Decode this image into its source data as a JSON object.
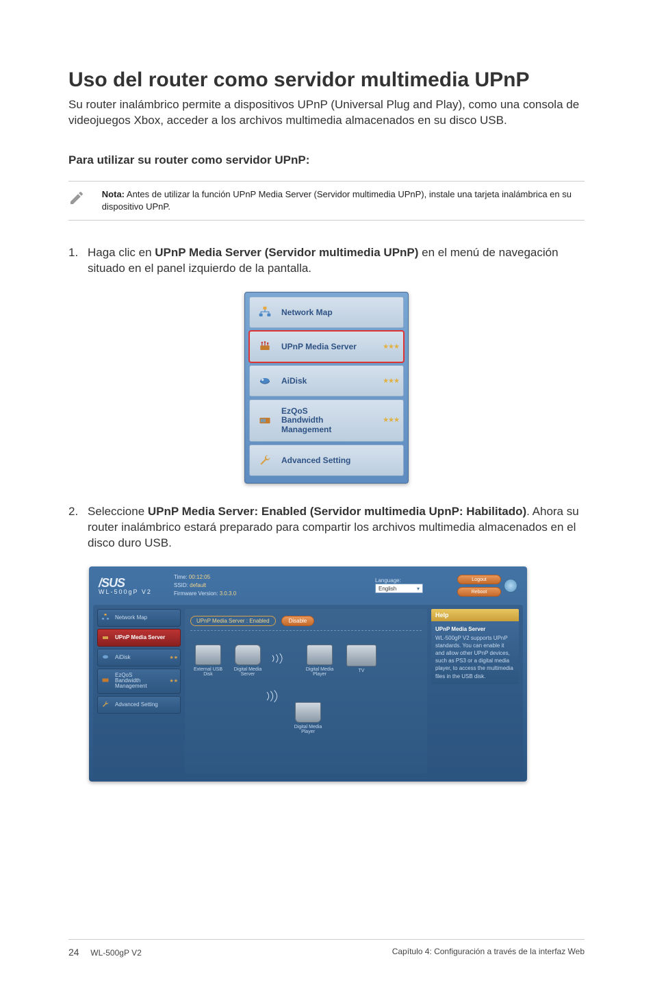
{
  "heading": "Uso del router como servidor multimedia UPnP",
  "intro": "Su router inalámbrico permite a dispositivos UPnP (Universal Plug and Play), como una consola de videojuegos Xbox, acceder a los archivos multimedia almacenados en su disco USB.",
  "subheading": "Para utilizar su router como servidor UPnP:",
  "note": {
    "label": "Nota:",
    "text": " Antes de utilizar la función UPnP Media Server (Servidor multimedia UPnP), instale una tarjeta inalámbrica en su dispositivo UPnP."
  },
  "steps": [
    {
      "num": "1.",
      "pre": "Haga clic en ",
      "bold": "UPnP Media Server (Servidor multimedia UPnP)",
      "post": " en el menú de navegación situado en el panel izquierdo de la pantalla."
    },
    {
      "num": "2.",
      "pre": "Seleccione ",
      "bold": "UPnP Media Server: Enabled (Servidor multimedia UpnP: Habilitado)",
      "post": ". Ahora su router inalámbrico estará preparado para compartir los archivos multimedia almacenados en el disco duro USB."
    }
  ],
  "navMenu": {
    "items": [
      {
        "label": "Network Map",
        "stars": ""
      },
      {
        "label": "UPnP Media Server",
        "stars": "★★★"
      },
      {
        "label": "AiDisk",
        "stars": "★★★"
      },
      {
        "label": "EzQoS Bandwidth Management",
        "stars": "★★★"
      },
      {
        "label": "Advanced Setting",
        "stars": ""
      }
    ]
  },
  "screenshot2": {
    "logo": "/SUS",
    "model": "WL-500gP V2",
    "info": {
      "timeLabel": "Time:",
      "timeVal": " 00:12:05",
      "ssidLabel": "SSID:",
      "ssidVal": " default",
      "fwLabel": "Firmware Version:",
      "fwVal": " 3.0.3.0"
    },
    "langLabel": "Language:",
    "langVal": "English",
    "logoutBtn": "Logout",
    "rebootBtn": "Reboot",
    "sidebar": [
      {
        "label": "Network Map",
        "active": false,
        "stars": ""
      },
      {
        "label": "UPnP Media Server",
        "active": true,
        "stars": ""
      },
      {
        "label": "AiDisk",
        "active": false,
        "stars": "★★"
      },
      {
        "label": "EzQoS Bandwidth Management",
        "active": false,
        "stars": "★★"
      },
      {
        "label": "Advanced Setting",
        "active": false,
        "stars": ""
      }
    ],
    "statusText": "UPnP Media Server : Enabled",
    "disableBtn": "Disable",
    "devices": {
      "usb": "External USB Disk",
      "dms": "Digital Media Server",
      "dmp1": "Digital Media Player",
      "tv": "TV",
      "dmp2": "Digital Media Player"
    },
    "help": {
      "title": "Help",
      "subTitle": "UPnP Media Server",
      "text": "WL-500gP V2 supports UPnP standards. You can enable it and allow other UPnP devices, such as PS3 or a digital media player, to access the multimedia files in the USB disk."
    }
  },
  "footer": {
    "pageNum": "24",
    "model": "WL-500gP V2",
    "chapter": "Capítulo 4: Configuración a través de la interfaz Web"
  }
}
